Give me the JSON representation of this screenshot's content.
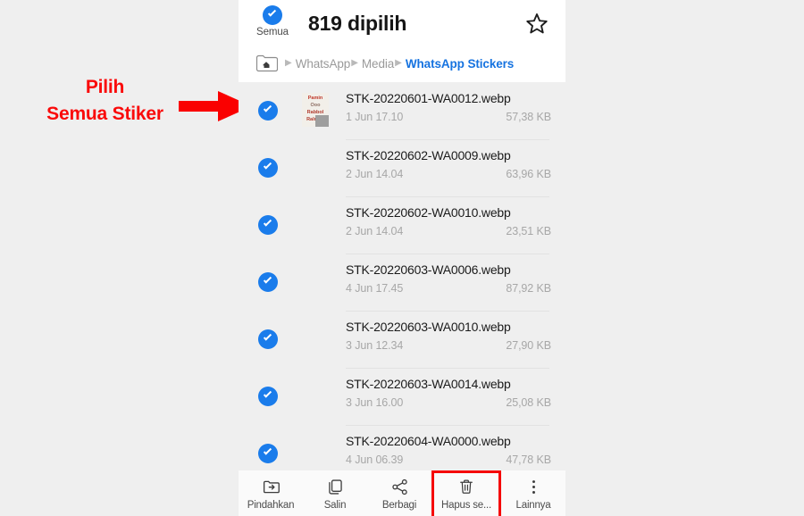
{
  "annotation": {
    "lines": [
      "Pilih",
      "Semua Stiker"
    ],
    "color": "#fa0a0a",
    "arrow_icon": "right-arrow-icon"
  },
  "header": {
    "select_all_label": "Semua",
    "select_all_icon": "check-circle-icon",
    "title": "819 dipilih",
    "favorite_icon": "star-outline-icon"
  },
  "breadcrumb": {
    "home_icon": "home-folder-icon",
    "separator": "▶",
    "items": [
      {
        "label": "WhatsApp",
        "active": false
      },
      {
        "label": "Media",
        "active": false
      },
      {
        "label": "WhatsApp Stickers",
        "active": true
      }
    ],
    "active_color": "#1673e0"
  },
  "file_list": {
    "checkbox_icon": "check-circle-icon",
    "checkbox_color": "#1a7ceb",
    "rows": [
      {
        "name": "STK-20220601-WA0012.webp",
        "date": "1 Jun 17.10",
        "size": "57,38 KB",
        "checked": true,
        "thumbnail": {
          "present": true,
          "lines": [
            "Pamin",
            "Ooo",
            "Rabbol",
            "Ralman"
          ]
        }
      },
      {
        "name": "STK-20220602-WA0009.webp",
        "date": "2 Jun 14.04",
        "size": "63,96 KB",
        "checked": true,
        "thumbnail": {
          "present": false,
          "lines": []
        }
      },
      {
        "name": "STK-20220602-WA0010.webp",
        "date": "2 Jun 14.04",
        "size": "23,51 KB",
        "checked": true,
        "thumbnail": {
          "present": false,
          "lines": []
        }
      },
      {
        "name": "STK-20220603-WA0006.webp",
        "date": "4 Jun 17.45",
        "size": "87,92 KB",
        "checked": true,
        "thumbnail": {
          "present": false,
          "lines": []
        }
      },
      {
        "name": "STK-20220603-WA0010.webp",
        "date": "3 Jun 12.34",
        "size": "27,90 KB",
        "checked": true,
        "thumbnail": {
          "present": false,
          "lines": []
        }
      },
      {
        "name": "STK-20220603-WA0014.webp",
        "date": "3 Jun 16.00",
        "size": "25,08 KB",
        "checked": true,
        "thumbnail": {
          "present": false,
          "lines": []
        }
      },
      {
        "name": "STK-20220604-WA0000.webp",
        "date": "4 Jun 06.39",
        "size": "47,78 KB",
        "checked": true,
        "thumbnail": {
          "present": false,
          "lines": []
        }
      }
    ]
  },
  "toolbar": {
    "items": [
      {
        "label": "Pindahkan",
        "icon": "move-to-folder-icon",
        "highlighted": false
      },
      {
        "label": "Salin",
        "icon": "copy-icon",
        "highlighted": false
      },
      {
        "label": "Berbagi",
        "icon": "share-icon",
        "highlighted": false
      },
      {
        "label": "Hapus se...",
        "icon": "trash-icon",
        "highlighted": true
      },
      {
        "label": "Lainnya",
        "icon": "more-vertical-icon",
        "highlighted": false
      }
    ],
    "highlight_color": "#f50505"
  }
}
